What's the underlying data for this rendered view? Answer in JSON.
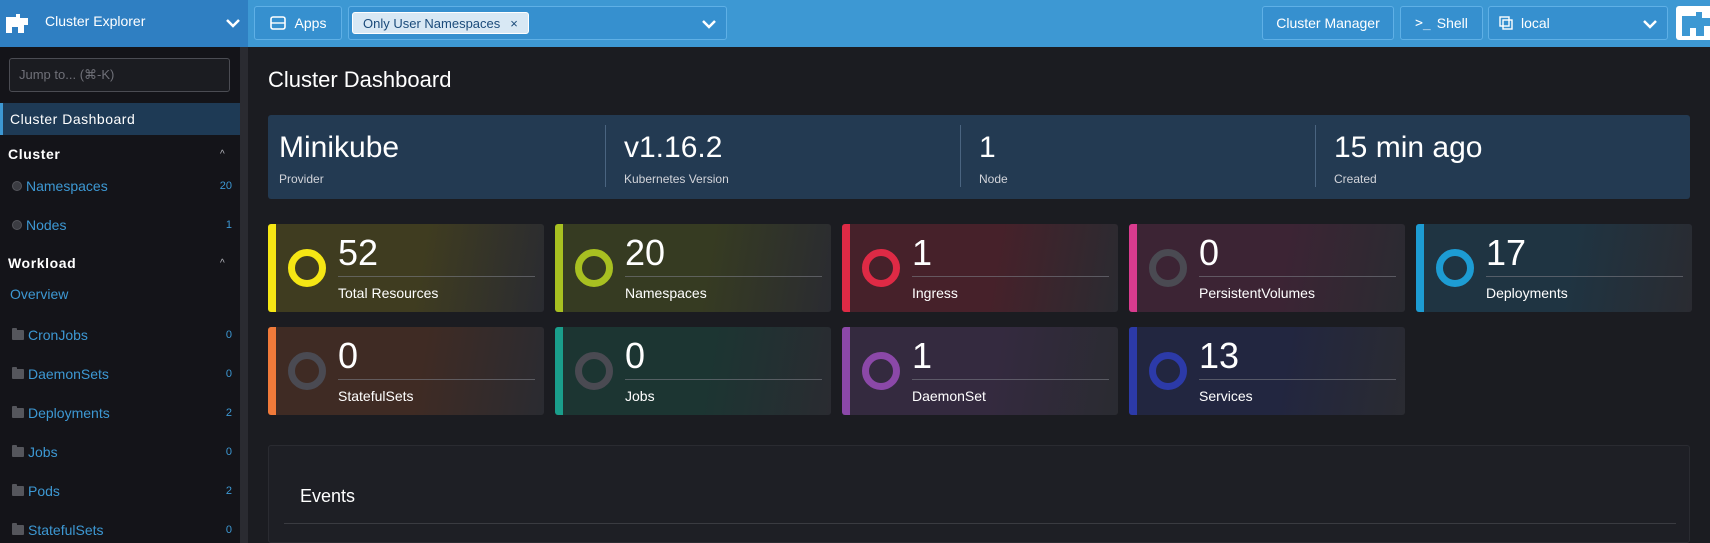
{
  "header": {
    "app_title": "Cluster Explorer",
    "apps_label": "Apps",
    "namespace_filter": "Only User Namespaces",
    "chip_remove": "×",
    "cluster_manager_label": "Cluster Manager",
    "shell_label": "Shell",
    "cluster_name": "local"
  },
  "sidebar": {
    "jump_placeholder": "Jump to... (⌘-K)",
    "active_item": "Cluster Dashboard",
    "groups": [
      {
        "label": "Cluster",
        "items": [
          {
            "label": "Namespaces",
            "count": "20",
            "icon": "circle-icon"
          },
          {
            "label": "Nodes",
            "count": "1",
            "icon": "circle-icon"
          }
        ]
      },
      {
        "label": "Workload",
        "overview": "Overview",
        "items": [
          {
            "label": "CronJobs",
            "count": "0",
            "icon": "folder-icon"
          },
          {
            "label": "DaemonSets",
            "count": "0",
            "icon": "folder-icon"
          },
          {
            "label": "Deployments",
            "count": "2",
            "icon": "folder-icon"
          },
          {
            "label": "Jobs",
            "count": "0",
            "icon": "folder-icon"
          },
          {
            "label": "Pods",
            "count": "2",
            "icon": "folder-icon"
          },
          {
            "label": "StatefulSets",
            "count": "0",
            "icon": "folder-icon"
          }
        ]
      }
    ]
  },
  "main": {
    "title": "Cluster Dashboard",
    "info": [
      {
        "value": "Minikube",
        "label": "Provider"
      },
      {
        "value": "v1.16.2",
        "label": "Kubernetes Version"
      },
      {
        "value": "1",
        "label": "Node"
      },
      {
        "value": "15 min ago",
        "label": "Created"
      }
    ],
    "tiles": [
      {
        "count": "52",
        "label": "Total Resources",
        "color": "#f5e614",
        "bg": "#3f3c20",
        "ring": "#f5e614"
      },
      {
        "count": "20",
        "label": "Namespaces",
        "color": "#a8c021",
        "bg": "#363b22",
        "ring": "#a8c021"
      },
      {
        "count": "1",
        "label": "Ingress",
        "color": "#de2a45",
        "bg": "#46212a",
        "ring": "#de2a45"
      },
      {
        "count": "0",
        "label": "PersistentVolumes",
        "color": "#d93b8e",
        "bg": "#3c2434",
        "ring": "#4a4a52"
      },
      {
        "count": "17",
        "label": "Deployments",
        "color": "#1d9cd3",
        "bg": "#1f3442",
        "ring": "#1d9cd3"
      },
      {
        "count": "0",
        "label": "StatefulSets",
        "color": "#f07a3a",
        "bg": "#3f2b24",
        "ring": "#4a4a52"
      },
      {
        "count": "0",
        "label": "Jobs",
        "color": "#1a9e8b",
        "bg": "#1c3532",
        "ring": "#4a4a52"
      },
      {
        "count": "1",
        "label": "DaemonSet",
        "color": "#8b48a8",
        "bg": "#342a3f",
        "ring": "#8b48a8"
      },
      {
        "count": "13",
        "label": "Services",
        "color": "#2c3aa8",
        "bg": "#222640",
        "ring": "#2c3aa8"
      }
    ],
    "events_title": "Events"
  }
}
